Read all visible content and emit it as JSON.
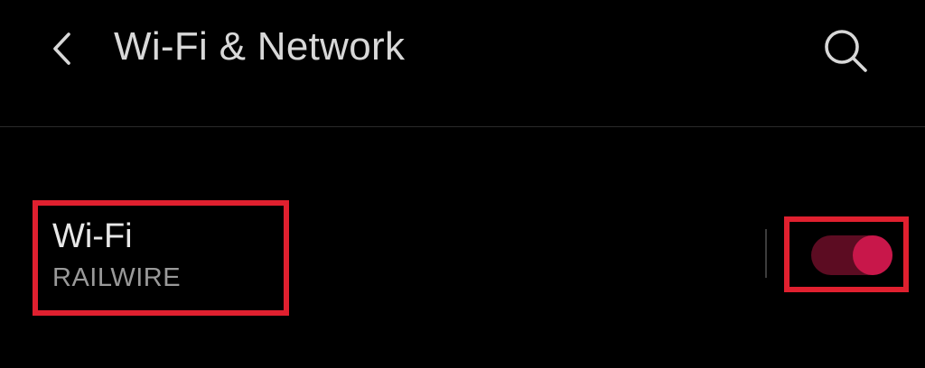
{
  "header": {
    "back_icon": "chevron-left-icon",
    "title": "Wi-Fi & Network",
    "search_icon": "search-icon"
  },
  "wifi": {
    "label": "Wi-Fi",
    "network_name": "RAILWIRE",
    "toggle_on": true
  },
  "colors": {
    "background": "#000000",
    "highlight_border": "#e0202f",
    "toggle_track": "#5c0c22",
    "toggle_thumb": "#c8174a"
  }
}
